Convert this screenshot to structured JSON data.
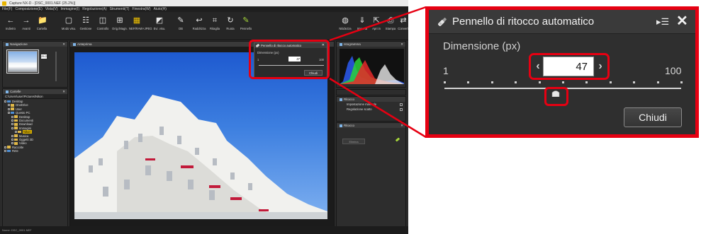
{
  "app": {
    "title": "Capture NX-D - [DSC_0001.NEF (25.2%)]",
    "menu": [
      "File(F)",
      "Composizione(E)",
      "Vista(V)",
      "Immagine(I)",
      "Regolazione(A)",
      "Strumenti(T)",
      "Finestra(W)",
      "Aiuto(H)"
    ],
    "toolbar": [
      {
        "label": "Indietro",
        "icon": "back-arrow-icon"
      },
      {
        "label": "Avanti",
        "icon": "forward-arrow-icon"
      },
      {
        "label": "Cartella",
        "icon": "folder-icon"
      },
      {
        "label": "Modo visu.",
        "icon": "view-mode-icon"
      },
      {
        "label": "Gestione",
        "icon": "filter-icon"
      },
      {
        "label": "Controllo",
        "icon": "compare-icon"
      },
      {
        "label": "Orig./Magn.",
        "icon": "zoom-icon"
      },
      {
        "label": "NEF/RAW+JPEG",
        "icon": "raw-jpeg-icon"
      },
      {
        "label": "Evi. visu.",
        "icon": "highlight-icon"
      },
      {
        "label": "DB",
        "icon": "brush-icon"
      },
      {
        "label": "Raddrizza",
        "icon": "straighten-icon"
      },
      {
        "label": "Ritaglia",
        "icon": "crop-icon"
      },
      {
        "label": "Ruota",
        "icon": "rotate-icon"
      },
      {
        "label": "Pennello",
        "icon": "retouch-brush-icon"
      },
      {
        "label": "Nitidezza",
        "icon": "sharpness-icon"
      },
      {
        "label": "Importa",
        "icon": "import-icon"
      },
      {
        "label": "Apri in",
        "icon": "open-with-icon"
      },
      {
        "label": "Stampa",
        "icon": "print-icon"
      },
      {
        "label": "Converti",
        "icon": "convert-icon"
      }
    ],
    "navigator": {
      "title": "Navigazione",
      "zoom": "25.2"
    },
    "folders": {
      "title": "Cartelle",
      "path": "C:\\Users\\user\\Pictures\\Nikon",
      "tree": [
        {
          "label": "Desktop",
          "indent": 0,
          "blue": true
        },
        {
          "label": "OneDrive",
          "indent": 1
        },
        {
          "label": "User",
          "indent": 1
        },
        {
          "label": "Questo PC",
          "indent": 1,
          "blue": true
        },
        {
          "label": "Desktop",
          "indent": 2
        },
        {
          "label": "Documenti",
          "indent": 2
        },
        {
          "label": "Download",
          "indent": 2
        },
        {
          "label": "Immagini",
          "indent": 2
        },
        {
          "label": "Nikon",
          "indent": 3,
          "selected": true
        },
        {
          "label": "Musica",
          "indent": 2
        },
        {
          "label": "Oggetti 3D",
          "indent": 2
        },
        {
          "label": "Video",
          "indent": 2
        },
        {
          "label": "Raccolte",
          "indent": 0
        },
        {
          "label": "Rete",
          "indent": 0,
          "blue": true
        }
      ]
    },
    "viewer": {
      "title": "Anteprima"
    },
    "histogram": {
      "title": "Istogramma",
      "channel": "RGB"
    },
    "adjustments": {
      "title": "Ritocco",
      "rows": [
        "Impostazione manuale",
        "Regolazione scatto"
      ]
    },
    "retouch_panel": {
      "title": "Ritocco",
      "button": "Elimina"
    },
    "status": "Nome: DSC_0001.NEF"
  },
  "dialog": {
    "title": "Pennello di ritocco automatico",
    "size_label": "Dimensione (px)",
    "min_label": "1",
    "max_label": "100",
    "value": "47",
    "slider_fraction": 0.47,
    "close_label": "Chiudi",
    "decrement_glyph": "‹",
    "increment_glyph": "›",
    "menu_glyph": "▸☰",
    "close_glyph": "✕",
    "accent_color": "#e60012"
  }
}
